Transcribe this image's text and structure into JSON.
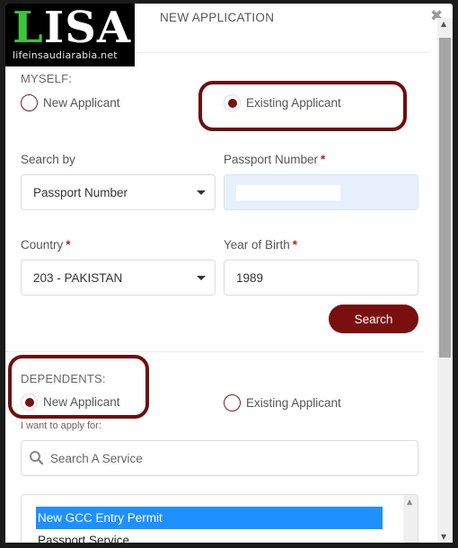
{
  "logo": {
    "letter_green": "L",
    "letters_white": "ISA",
    "subtitle": "lifeinsaudiarabia.net"
  },
  "header": {
    "title": "NEW APPLICATION",
    "close_icon": "✖"
  },
  "myself": {
    "label": "MYSELF:",
    "options": [
      {
        "label": "New Applicant",
        "checked": false
      },
      {
        "label": "Existing Applicant",
        "checked": true
      }
    ]
  },
  "search_by": {
    "label": "Search by",
    "value": "Passport Number"
  },
  "passport_number": {
    "label": "Passport Number",
    "required": "*",
    "value": ""
  },
  "country": {
    "label": "Country",
    "required": "*",
    "value": "203 - PAKISTAN"
  },
  "year_of_birth": {
    "label": "Year of Birth",
    "required": "*",
    "value": "1989"
  },
  "search_button": {
    "label": "Search"
  },
  "dependents": {
    "label": "DEPENDENTS:",
    "options": [
      {
        "label": "New Applicant",
        "checked": true
      },
      {
        "label": "Existing Applicant",
        "checked": false
      }
    ]
  },
  "apply_for": {
    "label": "I want to apply for:",
    "search_placeholder": "Search A Service",
    "services": [
      {
        "label": "New GCC Entry Permit",
        "selected": true
      },
      {
        "label": "Passport Service",
        "selected": false
      }
    ]
  },
  "colors": {
    "accent": "#7a0f0f",
    "highlight": "#6e0e0e",
    "selected_item": "#1e90ff",
    "required": "#c21a1a",
    "logo_green": "#3cc43c"
  }
}
